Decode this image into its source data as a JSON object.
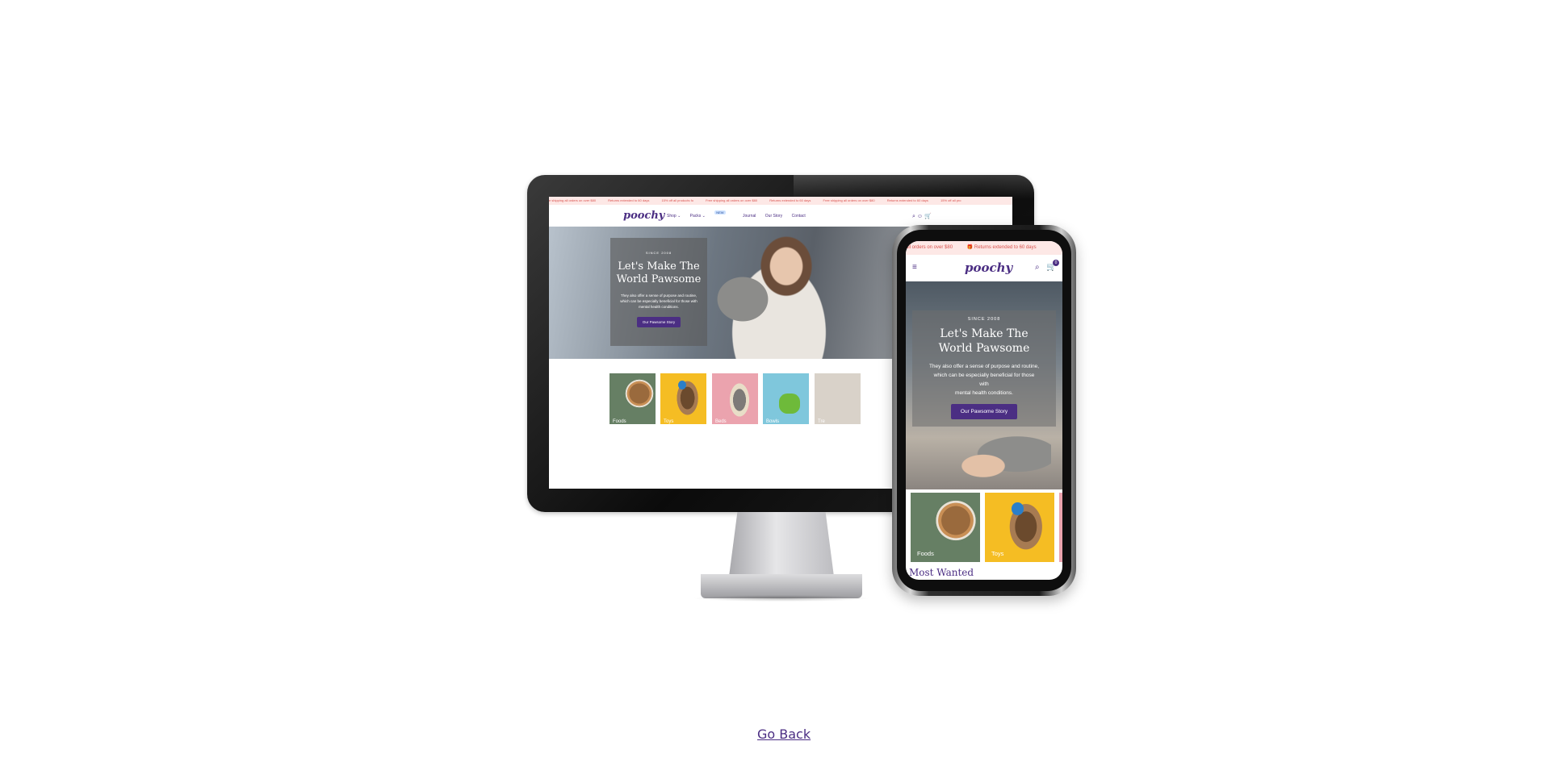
{
  "link": {
    "go_back": "Go Back"
  },
  "desktop": {
    "announcement": [
      "e shipping all orders on over $80",
      "Returns extended to 60 days",
      "15% off all products fo",
      "Free shipping all orders on over $80",
      "Returns extended to 60 days",
      "Free shipping all orders on over $80",
      "Returns extended to 60 days",
      "15% off all pro"
    ],
    "logo": "poochy",
    "menu": [
      "Shop ⌄",
      "Packs ⌄",
      "Journal",
      "Our Story",
      "Contact"
    ],
    "new_badge": "NEW",
    "hero": {
      "since": "SINCE 2008",
      "title_line1": "Let's Make The",
      "title_line2": "World Pawsome",
      "desc_line1": "They also offer a sense of purpose and routine,",
      "desc_line2": "which can be especially beneficial for those with",
      "desc_line3": "mental health conditions.",
      "button": "Our Pawsome Story"
    },
    "categories": [
      "Foods",
      "Toys",
      "Beds",
      "Bowls",
      "Tre"
    ]
  },
  "mobile": {
    "announcement_left": "all orders on over $80",
    "announcement_right": "Returns extended to 60 days",
    "logo": "poochy",
    "cart_count": "0",
    "hero": {
      "since": "SINCE 2008",
      "title_line1": "Let's Make The",
      "title_line2": "World Pawsome",
      "desc_line1": "They also offer a sense of purpose and routine,",
      "desc_line2": "which can be especially beneficial for those",
      "desc_line3": "with",
      "desc_line4": "mental health conditions.",
      "button": "Our Pawsome Story"
    },
    "categories": [
      "Foods",
      "Toys"
    ],
    "section_heading": "Most Wanted"
  },
  "colors": {
    "brand": "#4b2e83",
    "announce_bg": "#fde8e6",
    "announce_text": "#d9534f"
  },
  "icons": [
    "menu-icon",
    "search-icon",
    "user-icon",
    "cart-icon",
    "gift-icon"
  ]
}
